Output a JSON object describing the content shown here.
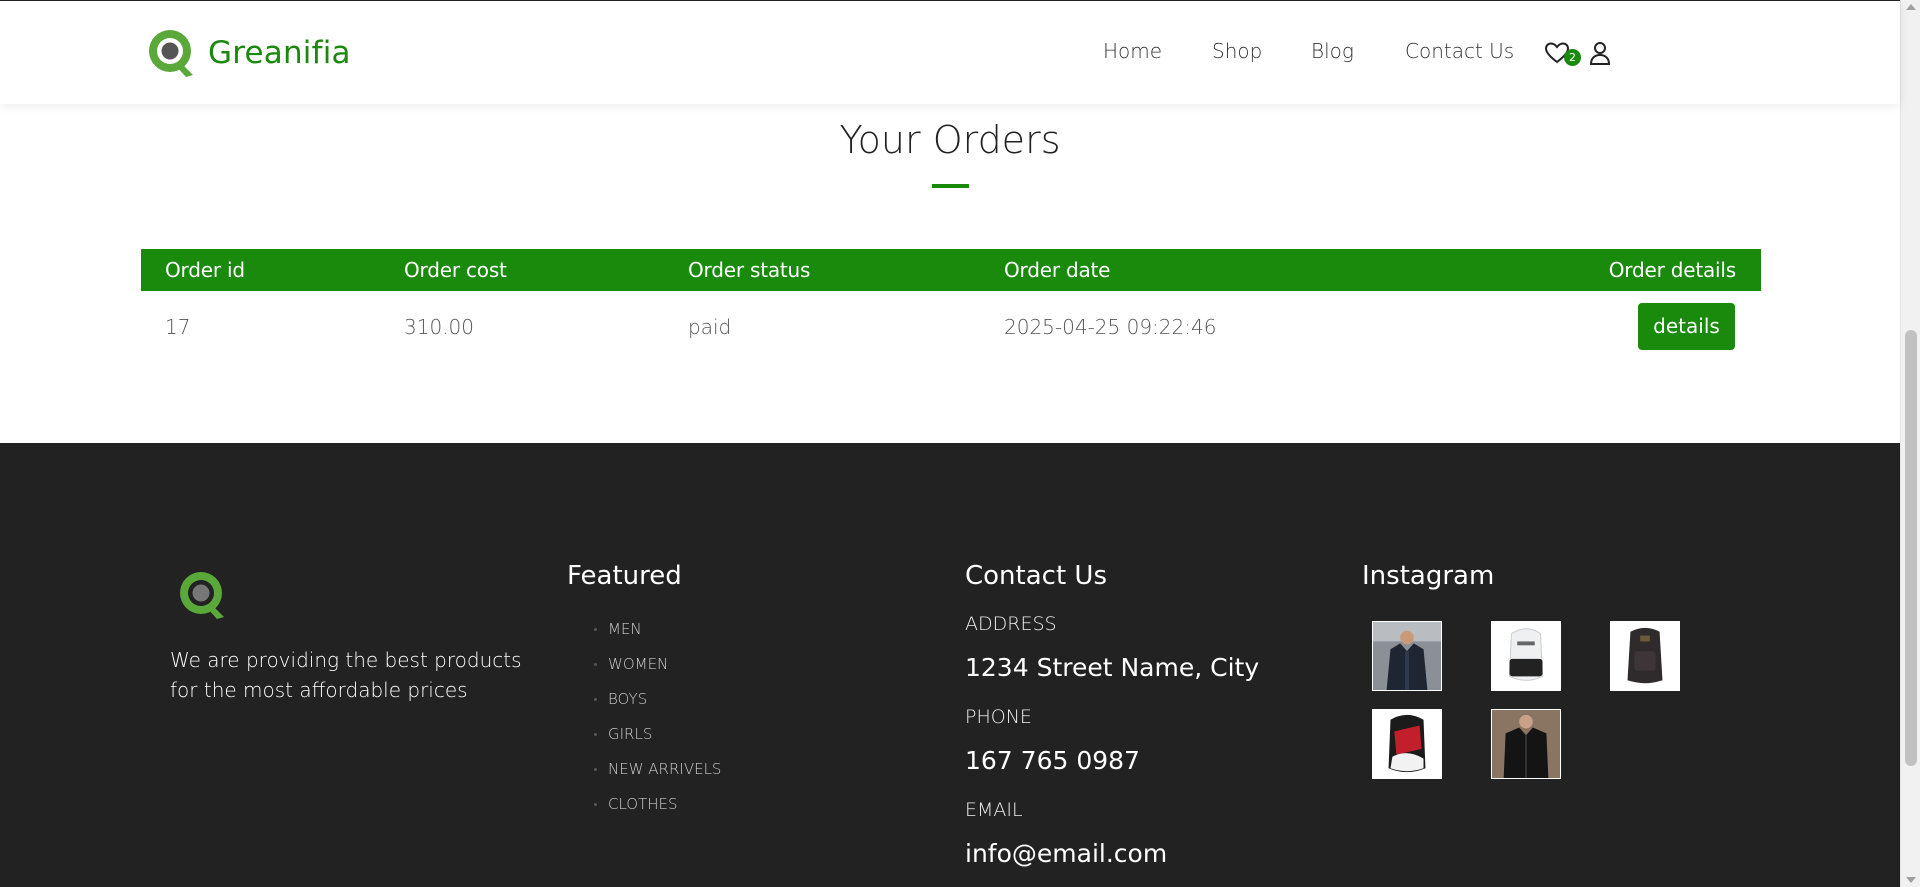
{
  "brand": {
    "name": "Greanifia",
    "accent": "#1a8a0c"
  },
  "nav": {
    "items": [
      {
        "label": "Home"
      },
      {
        "label": "Shop"
      },
      {
        "label": "Blog"
      },
      {
        "label": "Contact Us"
      }
    ],
    "wishlist_count": "2",
    "wishlist_icon": "heart-icon",
    "user_icon": "user-icon"
  },
  "main": {
    "title": "Your Orders",
    "table": {
      "headers": [
        "Order id",
        "Order cost",
        "Order status",
        "Order date",
        "Order details"
      ],
      "rows": [
        {
          "id": "17",
          "cost": "310.00",
          "status": "paid",
          "date": "2025-04-25 09:22:46",
          "action": "details"
        }
      ]
    }
  },
  "footer": {
    "about": "We are providing the best products for the most affordable prices",
    "featured": {
      "heading": "Featured",
      "items": [
        "MEN",
        "WOMEN",
        "BOYS",
        "GIRLS",
        "NEW ARRIVELS",
        "CLOTHES"
      ]
    },
    "contact": {
      "heading": "Contact Us",
      "address_label": "ADDRESS",
      "address": "1234 Street Name, City",
      "phone_label": "PHONE",
      "phone": "167 765 0987",
      "email_label": "EMAIL",
      "email": "info@email.com"
    },
    "instagram": {
      "heading": "Instagram",
      "images": [
        "coat-photo",
        "white-backpack-photo",
        "dark-backpack-photo",
        "red-backpack-photo",
        "black-jacket-photo"
      ]
    }
  }
}
